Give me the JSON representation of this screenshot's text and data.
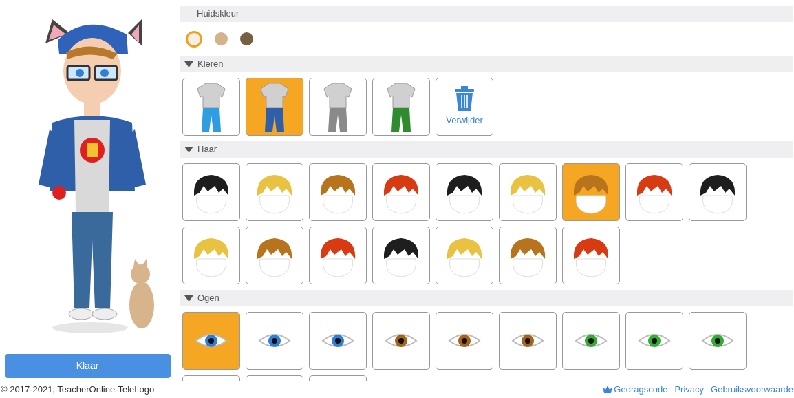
{
  "skin": {
    "title": "Huidskleur",
    "tones": [
      {
        "color": "#f6efe6",
        "selected": true
      },
      {
        "color": "#d3b38c",
        "selected": false
      },
      {
        "color": "#75603f",
        "selected": false
      }
    ]
  },
  "sections": [
    {
      "title": "Kleren",
      "kind": "clothes",
      "expanded": true,
      "items": [
        {
          "color": "#2f9de0",
          "selected": false
        },
        {
          "color": "#2f5fa8",
          "selected": true
        },
        {
          "color": "#8a8a8a",
          "selected": false
        },
        {
          "color": "#2e8b2e",
          "selected": false
        }
      ],
      "remove_label": "Verwijder"
    },
    {
      "title": "Haar",
      "kind": "hair",
      "expanded": true,
      "items": [
        {
          "color": "#1e1e1e",
          "selected": false
        },
        {
          "color": "#e8c240",
          "selected": false
        },
        {
          "color": "#b8741c",
          "selected": false
        },
        {
          "color": "#d83a12",
          "selected": false
        },
        {
          "color": "#1e1e1e",
          "selected": false
        },
        {
          "color": "#e8c240",
          "selected": false
        },
        {
          "color": "#b8741c",
          "selected": true
        },
        {
          "color": "#d83a12",
          "selected": false
        },
        {
          "color": "#1e1e1e",
          "selected": false
        },
        {
          "color": "#e8c240",
          "selected": false
        },
        {
          "color": "#b8741c",
          "selected": false
        },
        {
          "color": "#d83a12",
          "selected": false
        },
        {
          "color": "#1e1e1e",
          "selected": false
        },
        {
          "color": "#e8c240",
          "selected": false
        },
        {
          "color": "#b8741c",
          "selected": false
        },
        {
          "color": "#d83a12",
          "selected": false
        }
      ]
    },
    {
      "title": "Ogen",
      "kind": "eyes",
      "expanded": true,
      "items": [
        {
          "color": "#2f7fd8",
          "selected": true
        },
        {
          "color": "#2f7fd8",
          "selected": false
        },
        {
          "color": "#2f7fd8",
          "selected": false
        },
        {
          "color": "#a8631a",
          "selected": false
        },
        {
          "color": "#a8631a",
          "selected": false
        },
        {
          "color": "#a8631a",
          "selected": false
        },
        {
          "color": "#2fae2f",
          "selected": false
        },
        {
          "color": "#2fae2f",
          "selected": false
        },
        {
          "color": "#2fae2f",
          "selected": false
        },
        {
          "selected": false
        },
        {
          "selected": false
        },
        {
          "selected": false
        }
      ]
    }
  ],
  "done_button": "Klaar",
  "footer": {
    "copyright": "© 2017-2021, TeacherOnline-TeleLogo",
    "links": [
      {
        "label": "Gedragscode"
      },
      {
        "label": "Privacy"
      },
      {
        "label": "Gebruiksvoorwaarde"
      }
    ]
  }
}
